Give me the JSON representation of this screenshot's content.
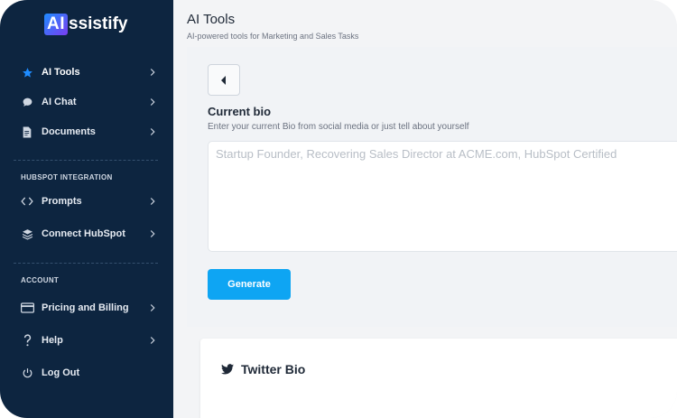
{
  "brand": {
    "logo_box": "AI",
    "logo_rest": "ssistify"
  },
  "sidebar": {
    "items": [
      {
        "label": "AI Tools",
        "icon": "star-icon"
      },
      {
        "label": "AI Chat",
        "icon": "chat-bubble-icon"
      },
      {
        "label": "Documents",
        "icon": "document-icon"
      }
    ],
    "sections": [
      {
        "label": "HUBSPOT INTEGRATION",
        "items": [
          {
            "label": "Prompts",
            "icon": "code-brackets-icon"
          },
          {
            "label": "Connect HubSpot",
            "icon": "layers-icon"
          }
        ]
      },
      {
        "label": "ACCOUNT",
        "items": [
          {
            "label": "Pricing and Billing",
            "icon": "credit-card-icon"
          },
          {
            "label": "Help",
            "icon": "question-icon"
          },
          {
            "label": "Log Out",
            "icon": "power-icon"
          }
        ]
      }
    ]
  },
  "header": {
    "title": "AI Tools",
    "subtitle": "AI-powered tools for Marketing and Sales Tasks"
  },
  "form": {
    "field_title": "Current bio",
    "field_desc": "Enter your current Bio from social media or just tell about yourself",
    "placeholder": "Startup Founder, Recovering Sales Director at ACME.com, HubSpot Certified",
    "value": "",
    "generate_label": "Generate"
  },
  "result": {
    "title": "Twitter Bio",
    "icon": "twitter-icon"
  },
  "colors": {
    "sidebar_bg": "#0d2540",
    "accent": "#0ea5f3",
    "active_icon": "#1e8cff"
  }
}
